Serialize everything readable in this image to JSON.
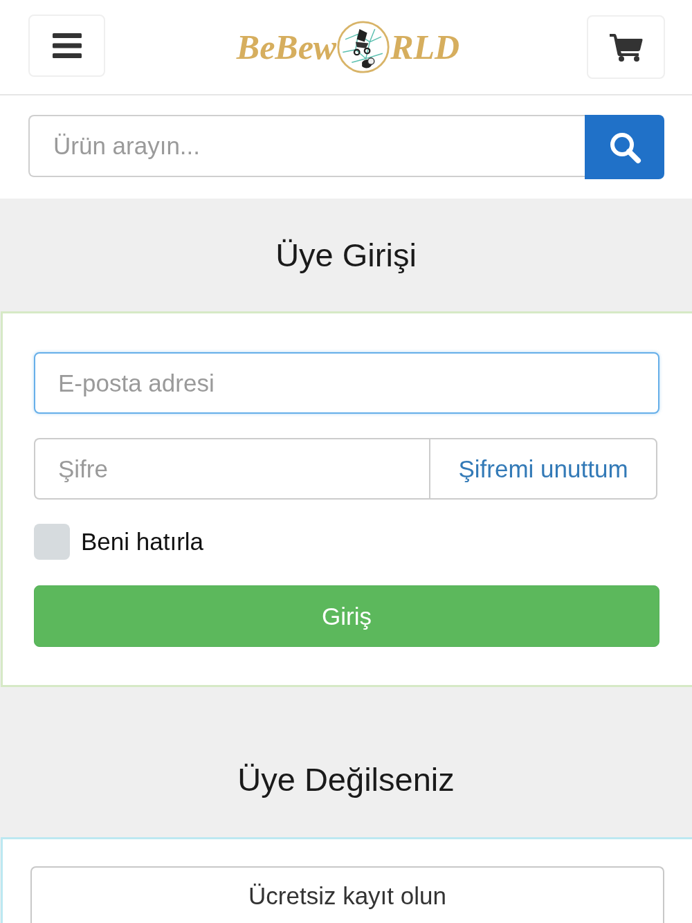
{
  "header": {
    "logo": {
      "before": "BeBew",
      "after": "RLD"
    }
  },
  "search": {
    "placeholder": "Ürün arayın..."
  },
  "login": {
    "title": "Üye Girişi",
    "email": {
      "placeholder": "E-posta adresi"
    },
    "password": {
      "placeholder": "Şifre"
    },
    "forgot_link": "Şifremi unuttum",
    "remember": {
      "label": "Beni hatırla",
      "checked": false
    },
    "submit": "Giriş"
  },
  "register": {
    "title": "Üye Değilseniz",
    "button": "Ücretsiz kayıt olun"
  }
}
